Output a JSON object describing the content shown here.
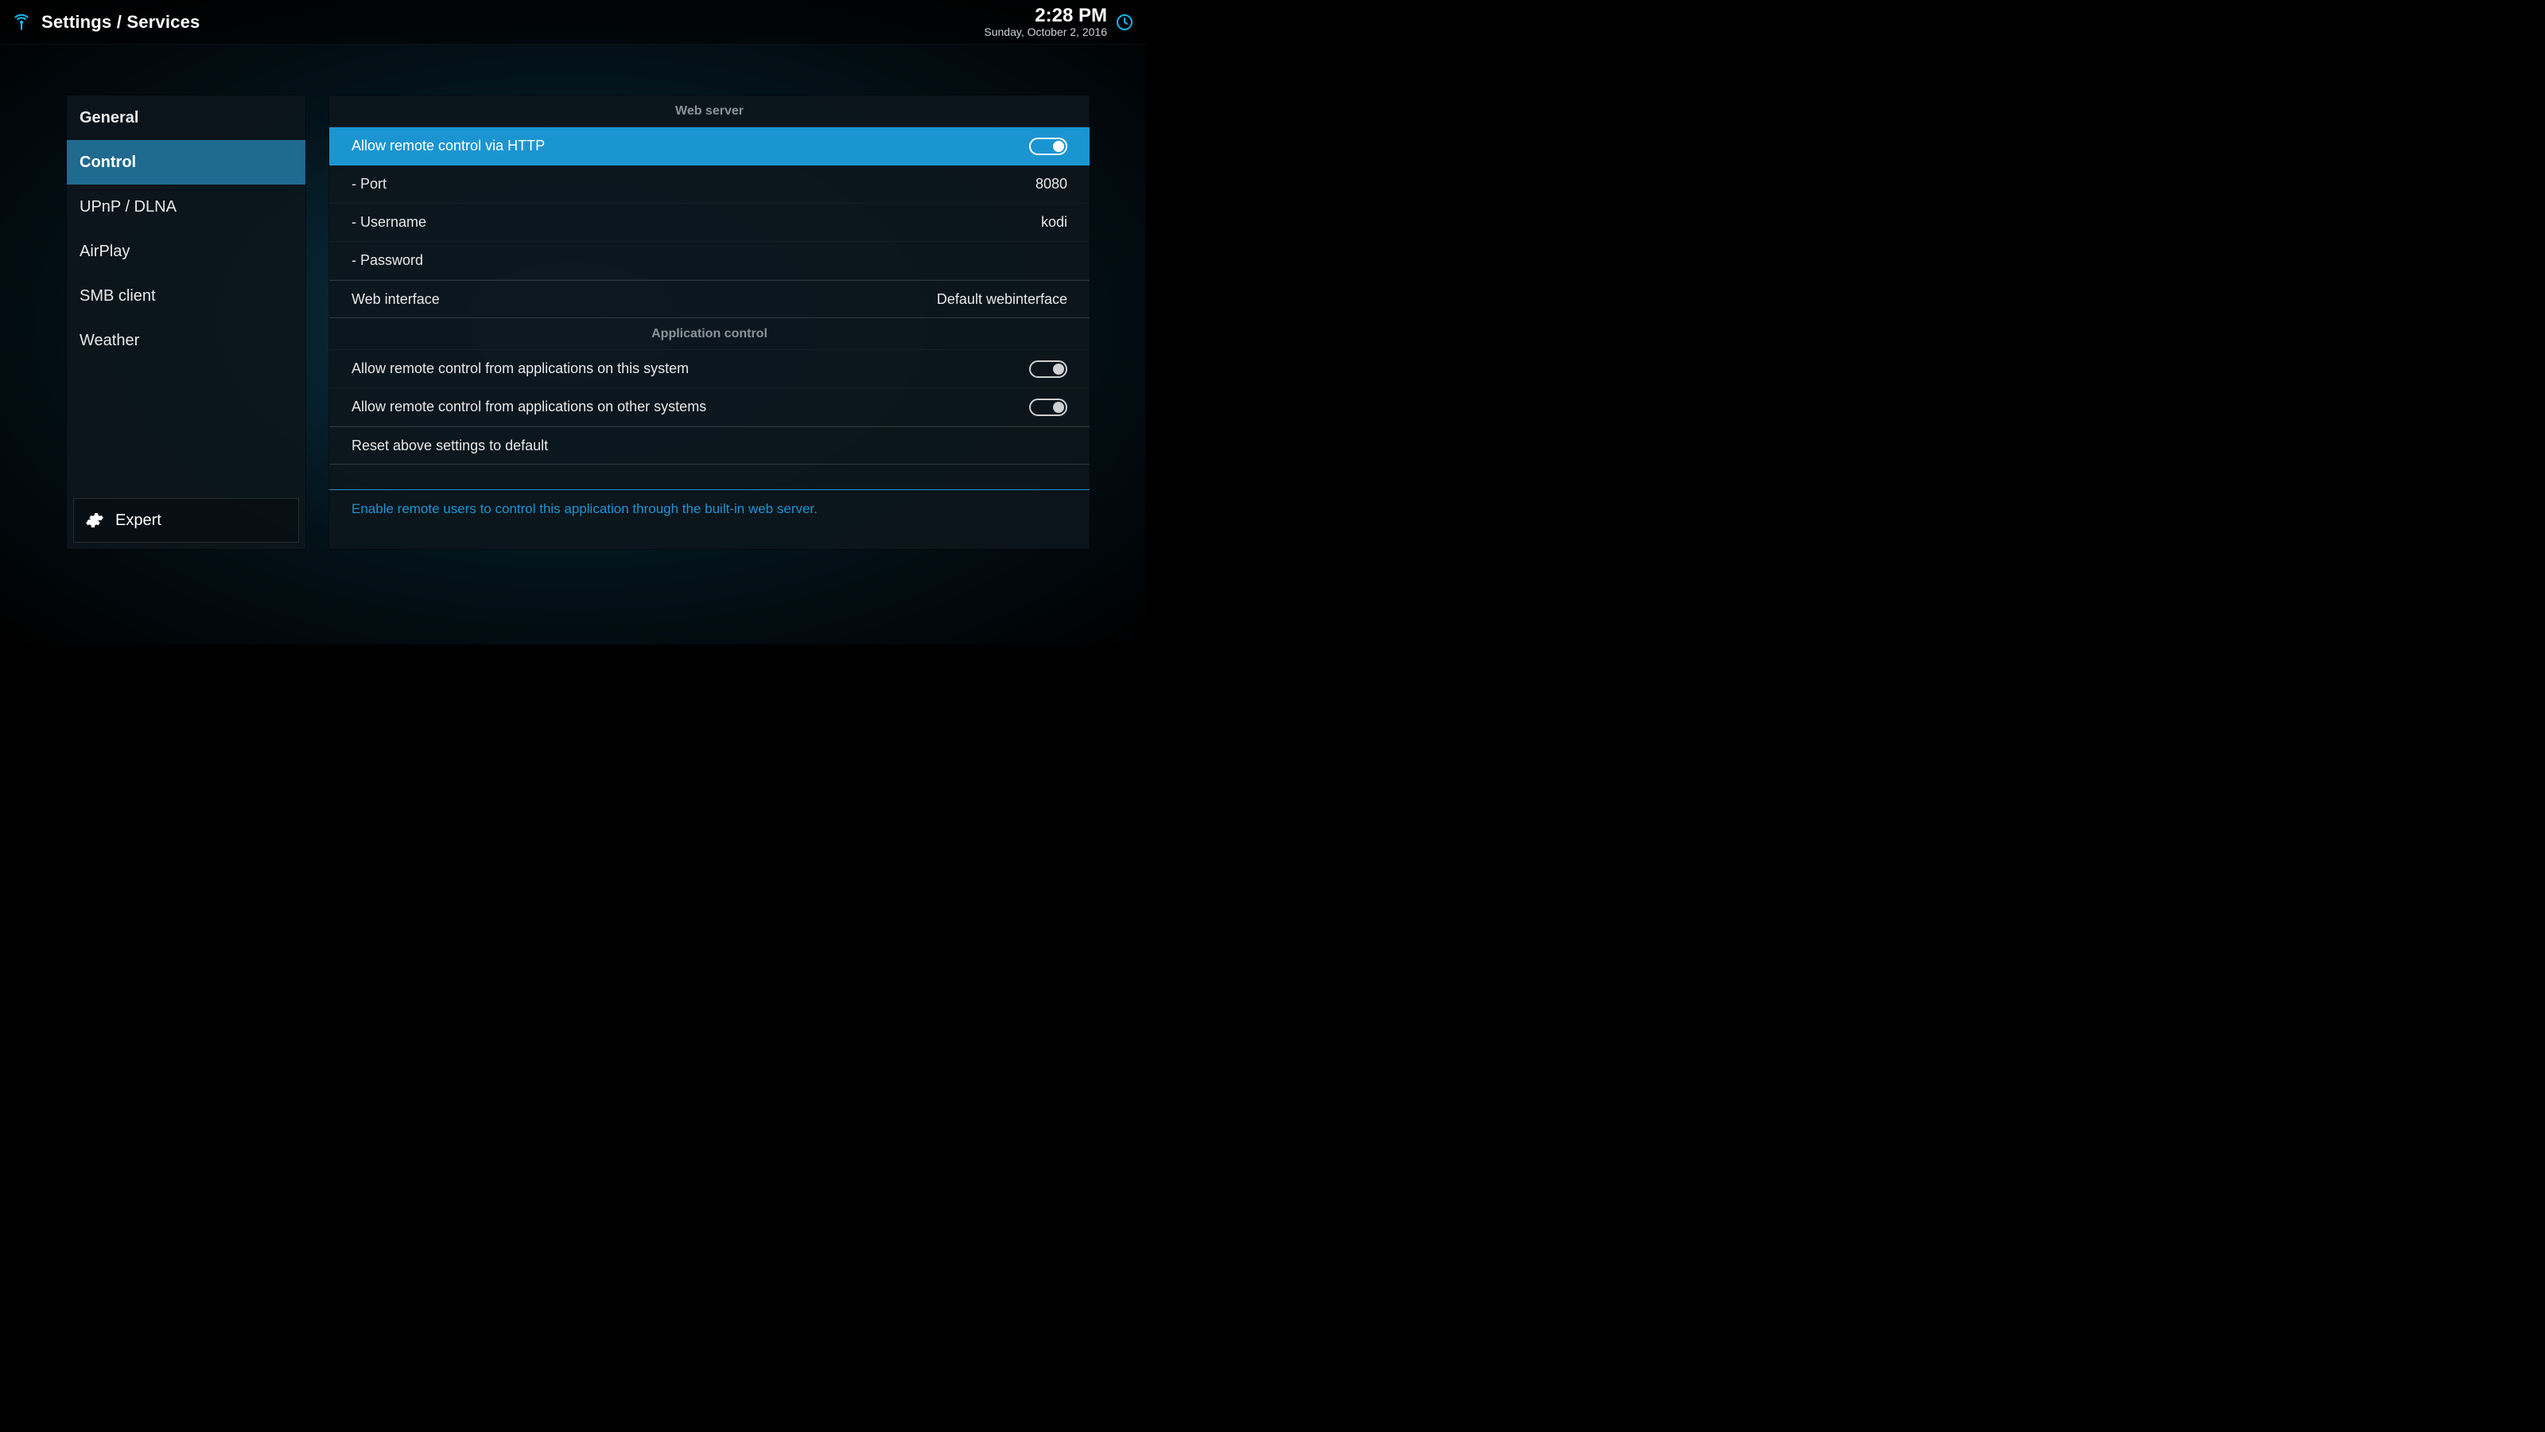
{
  "header": {
    "breadcrumb": "Settings / Services",
    "time": "2:28 PM",
    "date": "Sunday, October 2, 2016"
  },
  "sidebar": {
    "items": [
      {
        "label": "General",
        "selected": false
      },
      {
        "label": "Control",
        "selected": true
      },
      {
        "label": "UPnP / DLNA",
        "selected": false
      },
      {
        "label": "AirPlay",
        "selected": false
      },
      {
        "label": "SMB client",
        "selected": false
      },
      {
        "label": "Weather",
        "selected": false
      }
    ],
    "level_label": "Expert"
  },
  "main": {
    "sections": [
      {
        "title": "Web server",
        "rows": [
          {
            "type": "toggle",
            "label": "Allow remote control via HTTP",
            "on": true,
            "highlight": true
          },
          {
            "type": "value",
            "label": "Port",
            "value": "8080",
            "indent": true
          },
          {
            "type": "value",
            "label": "Username",
            "value": "kodi",
            "indent": true
          },
          {
            "type": "value",
            "label": "Password",
            "value": "",
            "indent": true
          },
          {
            "type": "value",
            "label": "Web interface",
            "value": "Default webinterface",
            "strong_border": true
          }
        ]
      },
      {
        "title": "Application control",
        "rows": [
          {
            "type": "toggle",
            "label": "Allow remote control from applications on this system",
            "on": true
          },
          {
            "type": "toggle",
            "label": "Allow remote control from applications on other systems",
            "on": true
          },
          {
            "type": "action",
            "label": "Reset above settings to default",
            "strong_border": true
          }
        ]
      }
    ],
    "description": "Enable remote users to control this application through the built-in web server."
  },
  "icons": {
    "wifi": "wifi-icon",
    "clock": "clock-icon",
    "gear": "gear-icon"
  },
  "colors": {
    "accent": "#1b95d1",
    "sidebar_selected": "#1f6a8f"
  }
}
